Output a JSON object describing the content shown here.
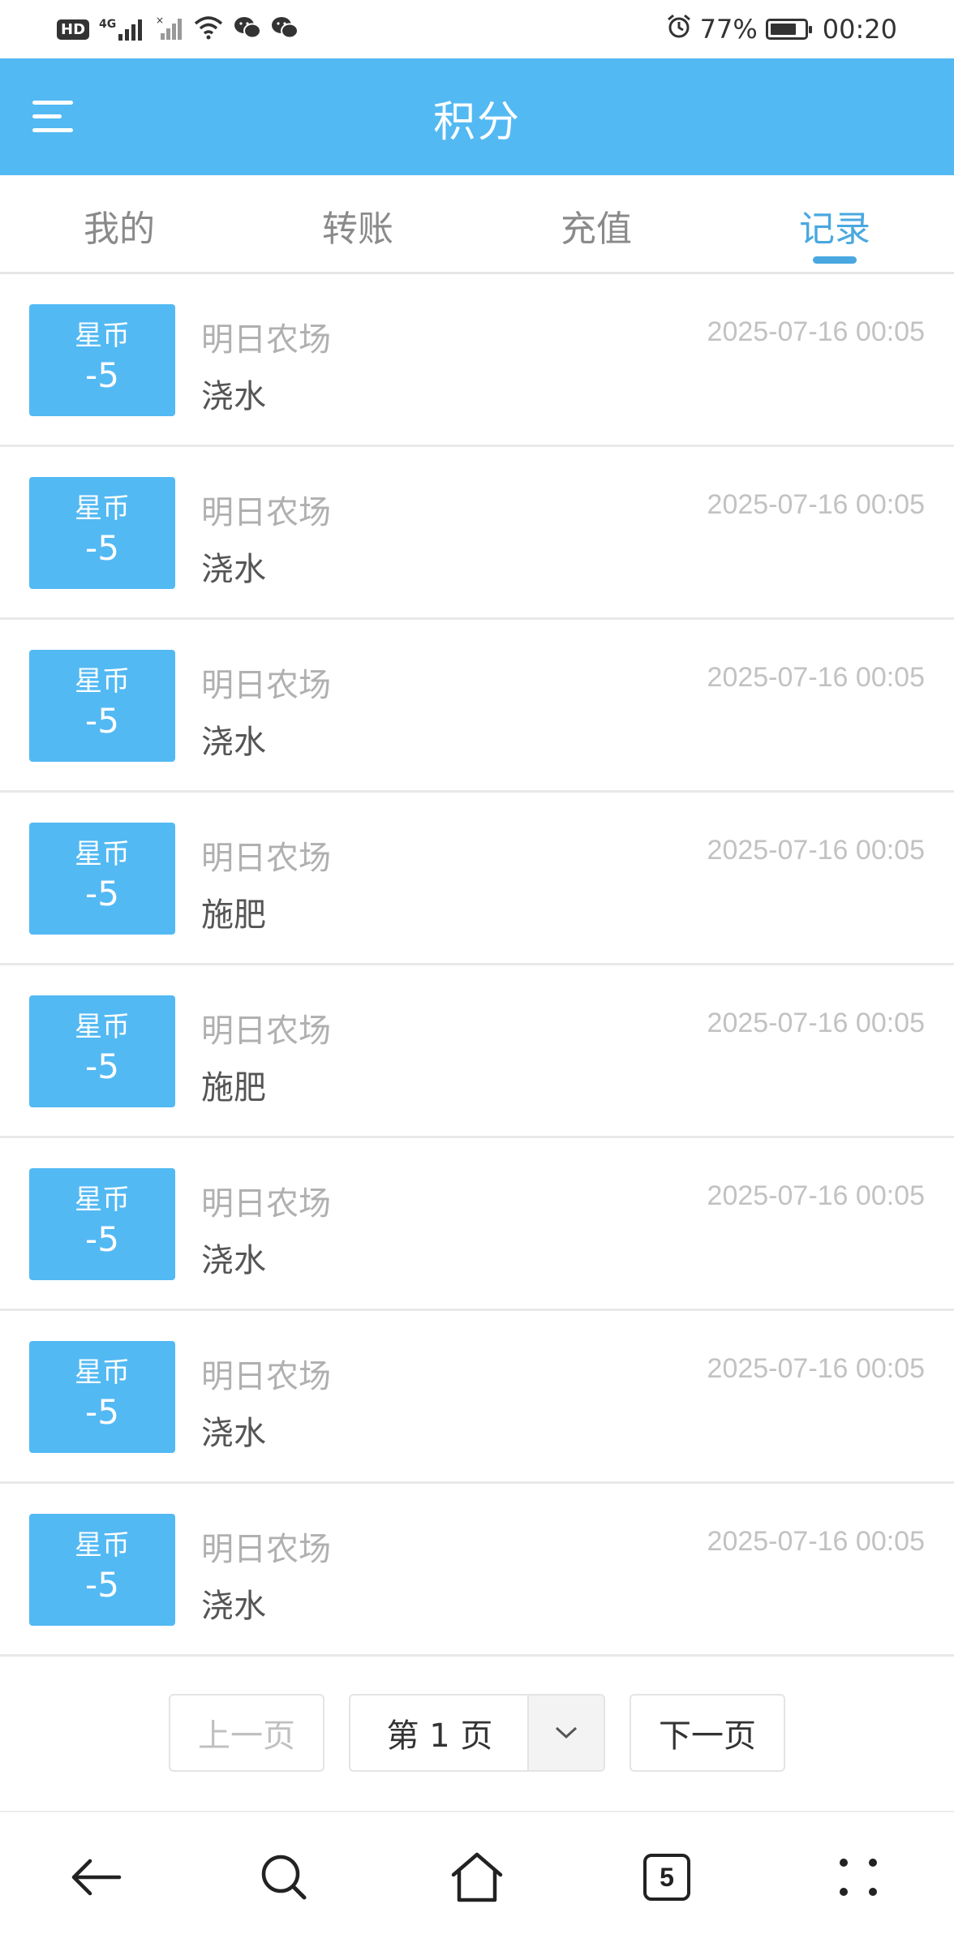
{
  "status_bar": {
    "network_badge": "HD",
    "network_type": "4G",
    "battery_percent": "77%",
    "battery_level": 0.77,
    "time": "00:20",
    "icons": [
      "hd-icon",
      "signal-4g-icon",
      "signal-no-service-icon",
      "wifi-icon",
      "wechat-icon",
      "wechat-icon",
      "alarm-icon",
      "battery-icon"
    ]
  },
  "header": {
    "title": "积分",
    "background_color": "#53b9f3",
    "menu_icon": "menu-icon"
  },
  "tabs": [
    {
      "label": "我的",
      "active": false
    },
    {
      "label": "转账",
      "active": false
    },
    {
      "label": "充值",
      "active": false
    },
    {
      "label": "记录",
      "active": true
    }
  ],
  "records": [
    {
      "currency": "星币",
      "amount": "-5",
      "source": "明日农场",
      "action": "浇水",
      "time": "2025-07-16 00:05"
    },
    {
      "currency": "星币",
      "amount": "-5",
      "source": "明日农场",
      "action": "浇水",
      "time": "2025-07-16 00:05"
    },
    {
      "currency": "星币",
      "amount": "-5",
      "source": "明日农场",
      "action": "浇水",
      "time": "2025-07-16 00:05"
    },
    {
      "currency": "星币",
      "amount": "-5",
      "source": "明日农场",
      "action": "施肥",
      "time": "2025-07-16 00:05"
    },
    {
      "currency": "星币",
      "amount": "-5",
      "source": "明日农场",
      "action": "施肥",
      "time": "2025-07-16 00:05"
    },
    {
      "currency": "星币",
      "amount": "-5",
      "source": "明日农场",
      "action": "浇水",
      "time": "2025-07-16 00:05"
    },
    {
      "currency": "星币",
      "amount": "-5",
      "source": "明日农场",
      "action": "浇水",
      "time": "2025-07-16 00:05"
    },
    {
      "currency": "星币",
      "amount": "-5",
      "source": "明日农场",
      "action": "浇水",
      "time": "2025-07-16 00:05"
    }
  ],
  "pagination": {
    "prev_label": "上一页",
    "page_label": "第 1 页",
    "next_label": "下一页",
    "dropdown_icon": "chevron-down-icon"
  },
  "bottom_nav": {
    "tab_count": "5",
    "icons": [
      "back-arrow-icon",
      "search-icon",
      "home-icon",
      "tabs-icon",
      "more-icon"
    ]
  }
}
